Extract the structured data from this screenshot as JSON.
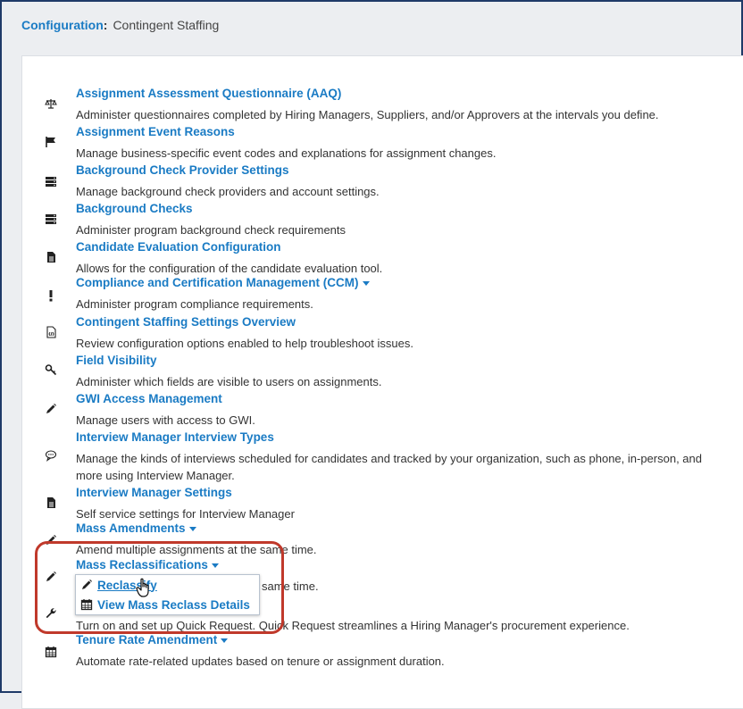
{
  "breadcrumb": {
    "root": "Configuration",
    "separator": ":",
    "current": "Contingent Staffing"
  },
  "items": [
    {
      "icon": "scale-icon",
      "title": "Assignment Assessment Questionnaire (AAQ)",
      "desc": "Administer questionnaires completed by Hiring Managers, Suppliers, and/or Approvers at the intervals you define."
    },
    {
      "icon": "flag-icon",
      "title": "Assignment Event Reasons",
      "desc": "Manage business-specific event codes and explanations for assignment changes."
    },
    {
      "icon": "server-icon",
      "title": "Background Check Provider Settings",
      "desc": "Manage background check providers and account settings."
    },
    {
      "icon": "server-icon",
      "title": "Background Checks",
      "desc": "Administer program background check requirements"
    },
    {
      "icon": "document-icon",
      "title": "Candidate Evaluation Configuration",
      "desc": "Allows for the configuration of the candidate evaluation tool."
    },
    {
      "icon": "exclamation-icon",
      "title": "Compliance and Certification Management (CCM)",
      "desc": "Administer program compliance requirements.",
      "dropdown": true
    },
    {
      "icon": "code-file-icon",
      "title": "Contingent Staffing Settings Overview",
      "desc": "Review configuration options enabled to help troubleshoot issues."
    },
    {
      "icon": "key-icon",
      "title": "Field Visibility",
      "desc": "Administer which fields are visible to users on assignments."
    },
    {
      "icon": "pencil-icon",
      "title": "GWI Access Management",
      "desc": "Manage users with access to GWI."
    },
    {
      "icon": "speech-bubble-icon",
      "title": "Interview Manager Interview Types",
      "desc": "Manage the kinds of interviews scheduled for candidates and tracked by your organization, such as phone, in-person, and more using Interview Manager."
    },
    {
      "icon": "document-icon",
      "title": "Interview Manager Settings",
      "desc": "Self service settings for Interview Manager"
    },
    {
      "icon": "pencil-icon",
      "title": "Mass Amendments",
      "desc": "Amend multiple assignments at the same time.",
      "dropdown": true
    },
    {
      "icon": "pencil-icon",
      "title": "Mass Reclassifications",
      "desc": "same time.",
      "dropdown": true
    },
    {
      "icon": "wrench-icon",
      "title": "",
      "desc": "Turn on and set up Quick Request. Quick Request streamlines a Hiring Manager's procurement experience."
    },
    {
      "icon": "calendar-icon",
      "title": "Tenure Rate Amendment",
      "desc": "Automate rate-related updates based on tenure or assignment duration.",
      "dropdown": true
    }
  ],
  "menu": {
    "items": [
      {
        "icon": "pencil-icon",
        "label": "Reclassify"
      },
      {
        "icon": "calendar-icon",
        "label": "View Mass Reclass Details"
      }
    ]
  },
  "colors": {
    "link": "#1a7bc4",
    "highlight": "#c0392b"
  }
}
